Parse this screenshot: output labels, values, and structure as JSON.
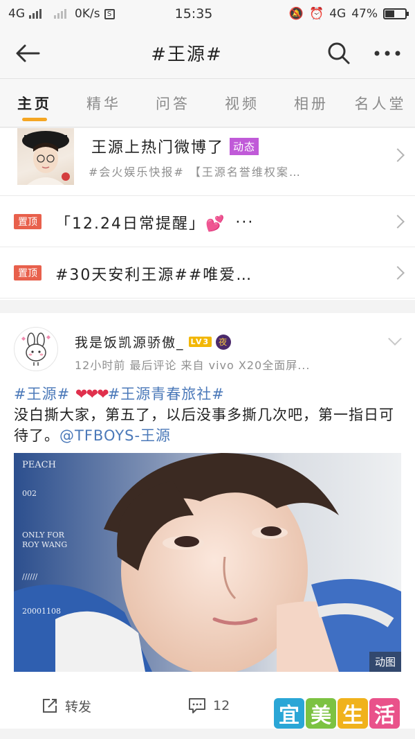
{
  "status_bar": {
    "network": "4G",
    "speed": "0K/s",
    "time": "15:35",
    "network_right": "4G",
    "battery_text": "47%",
    "battery_level": 0.47
  },
  "navbar": {
    "title": "#王源#",
    "icons": [
      "back-arrow-icon",
      "search-icon",
      "more-icon"
    ]
  },
  "tabs": [
    {
      "label": "主页",
      "active": true
    },
    {
      "label": "精华"
    },
    {
      "label": "问答"
    },
    {
      "label": "视频"
    },
    {
      "label": "相册"
    },
    {
      "label": "名人堂"
    }
  ],
  "hot": {
    "title": "王源上热门微博了",
    "badge": "动态",
    "subtitle": "#会火娱乐快报# 【王源名誉维权案…"
  },
  "pinned": [
    {
      "tag": "置顶",
      "text": "「12.24日常提醒」💕",
      "more": "···"
    },
    {
      "tag": "置顶",
      "text": "#30天安利王源##唯爱…"
    }
  ],
  "post": {
    "username": "我是饭凯源骄傲_",
    "level_badge": "LV3",
    "night_badge": "夜",
    "meta": "12小时前  最后评论  来自 vivo X20全面屏...",
    "hashtag1": "#王源#",
    "hearts": "❤❤❤",
    "hashtag2": "#王源青春旅社#",
    "body": "没白撕大家，第五了，以后没事多撕几次吧，第一指日可待了。",
    "mention": "@TFBOYS-王源",
    "image_watermark": {
      "line1": "PEACH",
      "line2": "002",
      "line3": "ONLY FOR",
      "line4": "ROY WANG",
      "line5": "//////",
      "line6": "20001108"
    },
    "gif_label": "动图",
    "repost_label": "转发",
    "comment_count": "12"
  },
  "watermark_logo": [
    "宜",
    "美",
    "生",
    "活"
  ],
  "colors": {
    "accent_tab": "#f5a623",
    "pin_tag": "#e8604c",
    "dyn_badge": "#c05ad8",
    "link": "#4b79b9",
    "logo_bg": [
      "#2aa6d6",
      "#7cc242",
      "#f0b21c",
      "#e9528a"
    ]
  }
}
